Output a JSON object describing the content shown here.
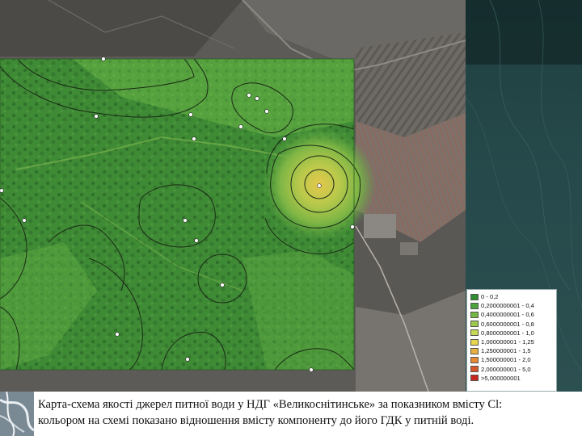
{
  "caption": {
    "line1": "Карта-схема якості джерел питної води у НДГ «Великоснітинське» за показником вмісту Cl:",
    "line2": "кольором на схемі показано відношення вмісту компоненту до його ГДК у питній воді."
  },
  "legend": {
    "items": [
      {
        "label": "0 - 0,2",
        "color": "#2f8f2f"
      },
      {
        "label": "0,2000000001 - 0,4",
        "color": "#4aa33b"
      },
      {
        "label": "0,4000000001 - 0,6",
        "color": "#72b843"
      },
      {
        "label": "0,6000000001 - 0,8",
        "color": "#9dca4c"
      },
      {
        "label": "0,8000000001 - 1,0",
        "color": "#c8da55"
      },
      {
        "label": "1,000000001 - 1,25",
        "color": "#e8d64d"
      },
      {
        "label": "1,250000001 - 1,5",
        "color": "#e9b13f"
      },
      {
        "label": "1,500000001 - 2,0",
        "color": "#e68a34"
      },
      {
        "label": "2,000000001 - 5,0",
        "color": "#d8572a"
      },
      {
        "label": ">5,000000001",
        "color": "#c7261f"
      }
    ]
  },
  "map": {
    "icons": {
      "sample_point": "sample-point-marker",
      "contour": "concentration-contour-line"
    }
  }
}
